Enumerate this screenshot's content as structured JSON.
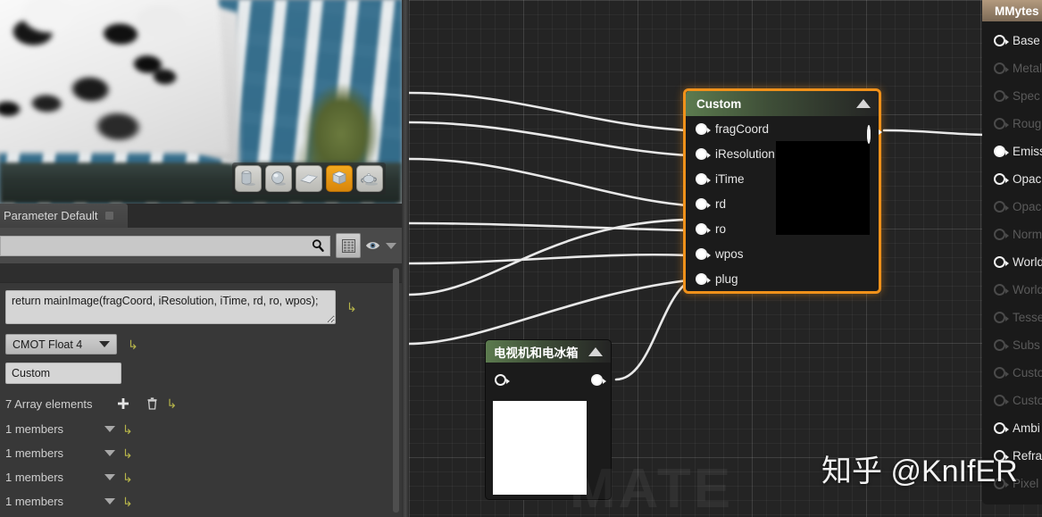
{
  "viewport": {
    "name": "material-preview-viewport",
    "shape_buttons": [
      {
        "name": "preview-shape-cylinder",
        "icon": "cylinder-icon",
        "label": "Cylinder",
        "active": false
      },
      {
        "name": "preview-shape-sphere",
        "icon": "sphere-icon",
        "label": "Sphere",
        "active": false
      },
      {
        "name": "preview-shape-plane",
        "icon": "plane-icon",
        "label": "Plane",
        "active": false
      },
      {
        "name": "preview-shape-cube",
        "icon": "cube-icon",
        "label": "Cube",
        "active": true
      },
      {
        "name": "preview-shape-teapot",
        "icon": "teapot-icon",
        "label": "Teapot",
        "active": false
      }
    ]
  },
  "tab": {
    "label": "Parameter Default",
    "close_icon": "close-icon"
  },
  "search": {
    "value": "",
    "placeholder": "",
    "search_icon": "search-icon",
    "grid_icon": "grid-view-icon",
    "eye_icon": "eye-visibility-icon",
    "caret_icon": "chevron-down-icon"
  },
  "details": {
    "code": "return mainImage(fragCoord, iResolution, iTime, rd, ro, wpos);",
    "output_type": "CMOT Float 4",
    "description": "Custom",
    "array_elements": "7 Array elements",
    "add_icon": "plus-icon",
    "delete_icon": "trash-icon",
    "reset_icon": "reset-arrow-icon",
    "members_rows": [
      {
        "label": "1 members"
      },
      {
        "label": "1 members"
      },
      {
        "label": "1 members"
      },
      {
        "label": "1 members"
      }
    ]
  },
  "graph": {
    "custom_node": {
      "title": "Custom",
      "collapse_icon": "triangle-up-icon",
      "selected_color": "#f0911a",
      "inputs": [
        {
          "label": "fragCoord",
          "connected": true
        },
        {
          "label": "iResolution",
          "connected": true
        },
        {
          "label": "iTime",
          "connected": true
        },
        {
          "label": "rd",
          "connected": true
        },
        {
          "label": "ro",
          "connected": true
        },
        {
          "label": "wpos",
          "connected": true
        },
        {
          "label": "plug",
          "connected": true
        }
      ],
      "output": {
        "label": "",
        "connected": true
      }
    },
    "cn_node": {
      "title": "电视机和电冰箱",
      "collapse_icon": "triangle-up-icon",
      "input": {
        "label": "",
        "connected": false
      },
      "output": {
        "label": "",
        "connected": true
      }
    },
    "material_node": {
      "title": "MMytes",
      "pins": [
        {
          "label": "Base",
          "enabled": true,
          "connected": false
        },
        {
          "label": "Metal",
          "enabled": false,
          "connected": false
        },
        {
          "label": "Spec",
          "enabled": false,
          "connected": false
        },
        {
          "label": "Roug",
          "enabled": false,
          "connected": false
        },
        {
          "label": "Emiss",
          "enabled": true,
          "connected": true
        },
        {
          "label": "Opac",
          "enabled": true,
          "connected": false
        },
        {
          "label": "Opac",
          "enabled": false,
          "connected": false
        },
        {
          "label": "Norm",
          "enabled": false,
          "connected": false
        },
        {
          "label": "World",
          "enabled": true,
          "connected": false
        },
        {
          "label": "World",
          "enabled": false,
          "connected": false
        },
        {
          "label": "Tesse",
          "enabled": false,
          "connected": false
        },
        {
          "label": "Subs",
          "enabled": false,
          "connected": false
        },
        {
          "label": "Custo",
          "enabled": false,
          "connected": false
        },
        {
          "label": "Custo",
          "enabled": false,
          "connected": false
        },
        {
          "label": "Ambi",
          "enabled": true,
          "connected": false
        },
        {
          "label": "Refra",
          "enabled": true,
          "connected": false
        },
        {
          "label": "Pixel",
          "enabled": false,
          "connected": false
        }
      ]
    },
    "watermark": "知乎 @KnIfER",
    "watermark_background": "MATE"
  }
}
